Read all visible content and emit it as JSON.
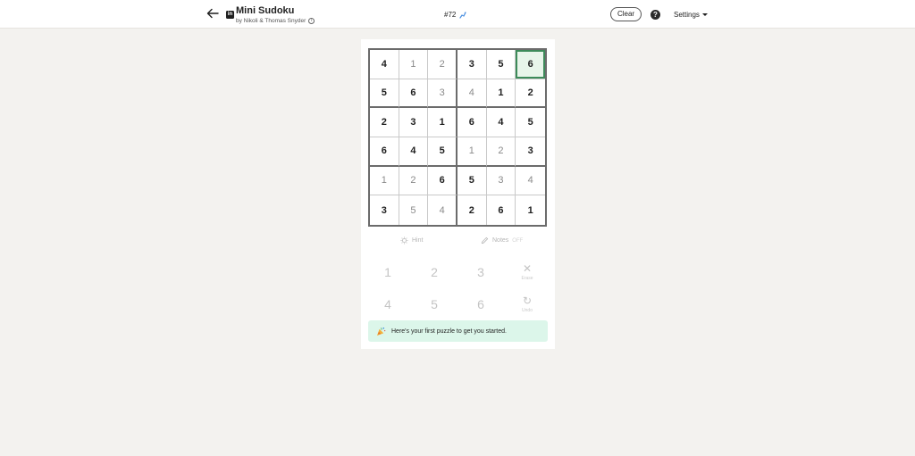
{
  "header": {
    "title": "Mini Sudoku",
    "byline": "by Nikoli & Thomas Snyder",
    "puzzle_number": "#72",
    "clear_label": "Clear",
    "help_symbol": "?",
    "settings_label": "Settings",
    "logo_text": "in"
  },
  "board": {
    "size": 6,
    "selected": {
      "row": 0,
      "col": 5
    },
    "rows": [
      [
        {
          "v": "4",
          "g": true
        },
        {
          "v": "1",
          "g": false
        },
        {
          "v": "2",
          "g": false
        },
        {
          "v": "3",
          "g": true
        },
        {
          "v": "5",
          "g": true
        },
        {
          "v": "6",
          "g": true
        }
      ],
      [
        {
          "v": "5",
          "g": true
        },
        {
          "v": "6",
          "g": true
        },
        {
          "v": "3",
          "g": false
        },
        {
          "v": "4",
          "g": false
        },
        {
          "v": "1",
          "g": true
        },
        {
          "v": "2",
          "g": true
        }
      ],
      [
        {
          "v": "2",
          "g": true
        },
        {
          "v": "3",
          "g": true
        },
        {
          "v": "1",
          "g": true
        },
        {
          "v": "6",
          "g": true
        },
        {
          "v": "4",
          "g": true
        },
        {
          "v": "5",
          "g": true
        }
      ],
      [
        {
          "v": "6",
          "g": true
        },
        {
          "v": "4",
          "g": true
        },
        {
          "v": "5",
          "g": true
        },
        {
          "v": "1",
          "g": false
        },
        {
          "v": "2",
          "g": false
        },
        {
          "v": "3",
          "g": true
        }
      ],
      [
        {
          "v": "1",
          "g": false
        },
        {
          "v": "2",
          "g": false
        },
        {
          "v": "6",
          "g": true
        },
        {
          "v": "5",
          "g": true
        },
        {
          "v": "3",
          "g": false
        },
        {
          "v": "4",
          "g": false
        }
      ],
      [
        {
          "v": "3",
          "g": true
        },
        {
          "v": "5",
          "g": false
        },
        {
          "v": "4",
          "g": false
        },
        {
          "v": "2",
          "g": true
        },
        {
          "v": "6",
          "g": true
        },
        {
          "v": "1",
          "g": true
        }
      ]
    ]
  },
  "tools": {
    "hint_label": "Hint",
    "notes_label": "Notes",
    "notes_state": "OFF"
  },
  "numpad": {
    "keys": [
      "1",
      "2",
      "3",
      "4",
      "5",
      "6"
    ],
    "erase_label": "Erase",
    "erase_symbol": "✕",
    "undo_label": "Undo",
    "undo_symbol": "↻"
  },
  "banner": {
    "text": "Here's your first puzzle to get you started."
  },
  "colors": {
    "background": "#f3f2ef",
    "selected_border": "#3d8b5a",
    "selected_fill": "#e8f5ea",
    "banner_bg": "#dcf6ea"
  }
}
